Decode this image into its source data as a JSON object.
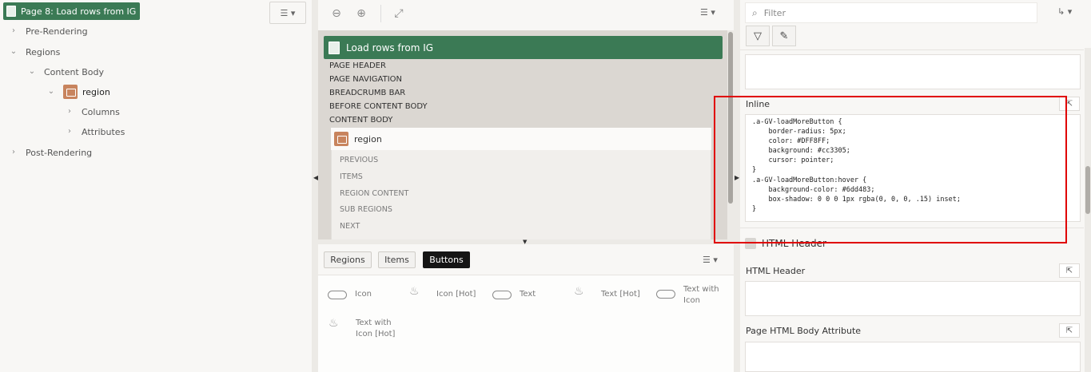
{
  "tree": {
    "page_node": "Page 8: Load rows from IG",
    "items": [
      {
        "label": "Pre-Rendering"
      },
      {
        "label": "Regions"
      },
      {
        "label": "Content Body"
      },
      {
        "label": "region"
      },
      {
        "label": "Columns"
      },
      {
        "label": "Attributes"
      },
      {
        "label": "Post-Rendering"
      }
    ],
    "menu_icon": "hamburger-icon"
  },
  "layout_editor": {
    "page_title": "Load rows from IG",
    "positions": [
      "PAGE HEADER",
      "PAGE NAVIGATION",
      "BREADCRUMB BAR",
      "BEFORE CONTENT BODY",
      "CONTENT BODY"
    ],
    "region_title": "region",
    "region_positions": [
      "PREVIOUS",
      "ITEMS",
      "REGION CONTENT",
      "SUB REGIONS",
      "NEXT"
    ],
    "zoom_out_icon": "zoom-out-icon",
    "zoom_in_icon": "zoom-in-icon",
    "expand_icon": "expand-icon"
  },
  "gallery": {
    "tabs": [
      {
        "label": "Regions",
        "active": false
      },
      {
        "label": "Items",
        "active": false
      },
      {
        "label": "Buttons",
        "active": true
      }
    ],
    "items": [
      {
        "label": "Icon",
        "icon": "pill-icon"
      },
      {
        "label": "Icon [Hot]",
        "icon": "flame-icon"
      },
      {
        "label": "Text",
        "icon": "pill-icon"
      },
      {
        "label": "Text [Hot]",
        "icon": "flame-icon"
      },
      {
        "label_line1": "Text with",
        "label_line2": "Icon",
        "icon": "pill-icon"
      },
      {
        "label_line1": "Text with",
        "label_line2": "Icon [Hot]",
        "icon": "flame-icon"
      }
    ]
  },
  "properties": {
    "filter_placeholder": "Filter",
    "inline_label": "Inline",
    "inline_css": ".a-GV-loadMoreButton {\n    border-radius: 5px;\n    color: #DFF8FF;\n    background: #cc3305;\n    cursor: pointer;\n}\n.a-GV-loadMoreButton:hover {\n    background-color: #6dd483;\n    box-shadow: 0 0 0 1px rgba(0, 0, 0, .15) inset;\n}",
    "section_html_header": "HTML Header",
    "html_header_label": "HTML Header",
    "body_attr_label": "Page HTML Body Attribute"
  },
  "colors": {
    "accent_green": "#3b7a55",
    "region_orange": "#c8845e",
    "highlight_red": "#e00000"
  }
}
